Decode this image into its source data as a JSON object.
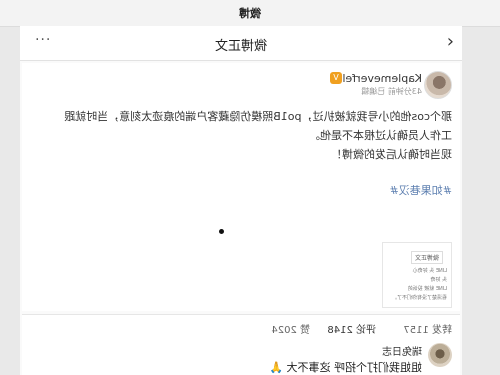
{
  "app": {
    "title": "微博"
  },
  "nav": {
    "title": "微博正文",
    "back_icon": "chevron-left-icon",
    "more_label": "···"
  },
  "post": {
    "username": "Kaplemeverfell",
    "meta": "43分钟前 已编辑",
    "content": [
      "那个cos他的小号我就被扒过，po1B照模仿隐藏客户端的痕迹太刻意，当时就跟",
      "工作人员确认过根本不是他。",
      "现当时确认后发的微博！"
    ],
    "topic": "#如果巷汉#",
    "quote_card": {
      "chip": "微博正文",
      "lines": [
        "LINE 头 好奇心",
        "头 好奇",
        "LINE 就被 投诉的",
        "看清楚了没有你们不了。"
      ]
    }
  },
  "tabs": [
    {
      "label": "转发 1157",
      "active": false
    },
    {
      "label": "评论 2148",
      "active": true
    },
    {
      "label": "赞 2024",
      "active": false
    }
  ],
  "comment": {
    "name": "瑞兔日志",
    "text": "姐姐我们打个招呼 这事不大 🙏"
  },
  "colors": {
    "link": "#5d7fb0",
    "badge": "#f0a020"
  }
}
